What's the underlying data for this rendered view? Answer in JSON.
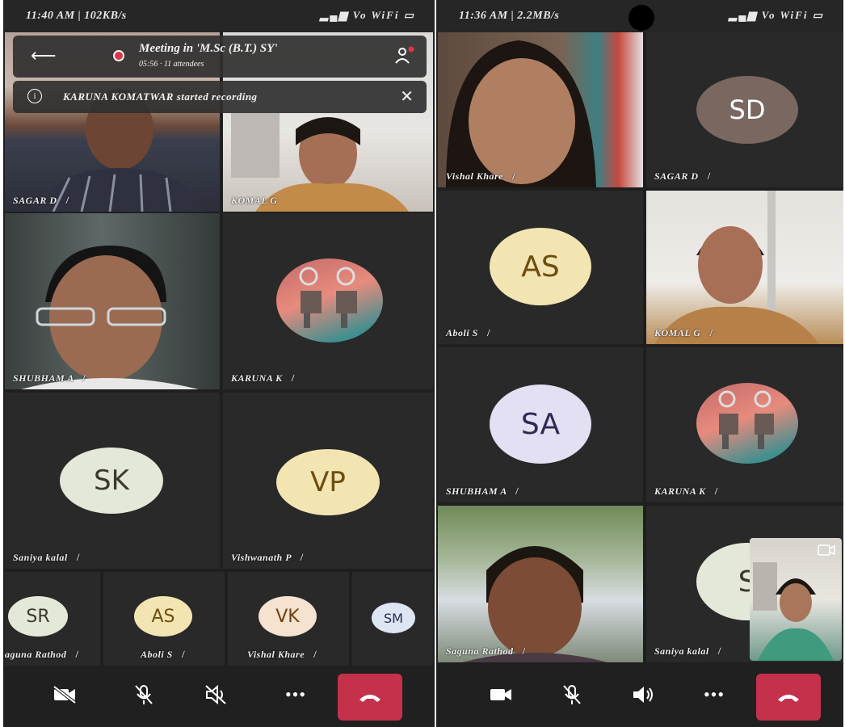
{
  "left": {
    "status": {
      "time": "11:40 AM | 102KB/s",
      "system": "Vo WiFi"
    },
    "meeting": {
      "title": "Meeting in 'M.Sc (B.T.) SY'",
      "subtitle": "05:56 · 11 attendees"
    },
    "notification": {
      "text": "KARUNA KOMATWAR started recording"
    },
    "tiles": {
      "sagar": "SAGAR D",
      "komal": "KOMAL G",
      "shubham": "SHUBHAM A",
      "karuna": "KARUNA K",
      "saniya": "Saniya kalal",
      "vishwanath": "Vishwanath P"
    },
    "avatars": {
      "saniya": "SK",
      "vishwanath": "VP"
    },
    "strip": [
      {
        "initials": "SR",
        "name": "aguna Rathod"
      },
      {
        "initials": "AS",
        "name": "Aboli S"
      },
      {
        "initials": "VK",
        "name": "Vishal Khare"
      },
      {
        "initials": "SM",
        "name": ""
      }
    ]
  },
  "right": {
    "status": {
      "time": "11:36 AM | 2.2MB/s",
      "system": "Vo WiFi"
    },
    "tiles": {
      "vishal": "Vishal Khare",
      "sagar": "SAGAR D",
      "aboli": "Aboli S",
      "komal": "KOMAL G",
      "shubham": "SHUBHAM A",
      "karuna": "KARUNA K",
      "saguna": "Saguna Rathod",
      "saniya": "Saniya kalal"
    },
    "avatars": {
      "sagar": "SD",
      "aboli": "AS",
      "shubham": "SA",
      "saniya": "S"
    }
  },
  "colors": {
    "end_call": "#c4314b",
    "avatar_yellow": "#f3e5b2",
    "avatar_lavender": "#e4e0f3",
    "avatar_green": "#e3e8d8",
    "avatar_peach": "#f5e3cf",
    "avatar_brown": "#7a6760",
    "avatar_blue": "#dfe6f3"
  },
  "icons": [
    "back-arrow-icon",
    "record-dot-icon",
    "participants-icon",
    "info-icon",
    "close-icon",
    "mic-muted-icon",
    "camera-off-icon",
    "camera-icon",
    "speaker-off-icon",
    "speaker-icon",
    "more-icon",
    "hang-up-icon",
    "switch-camera-icon"
  ]
}
